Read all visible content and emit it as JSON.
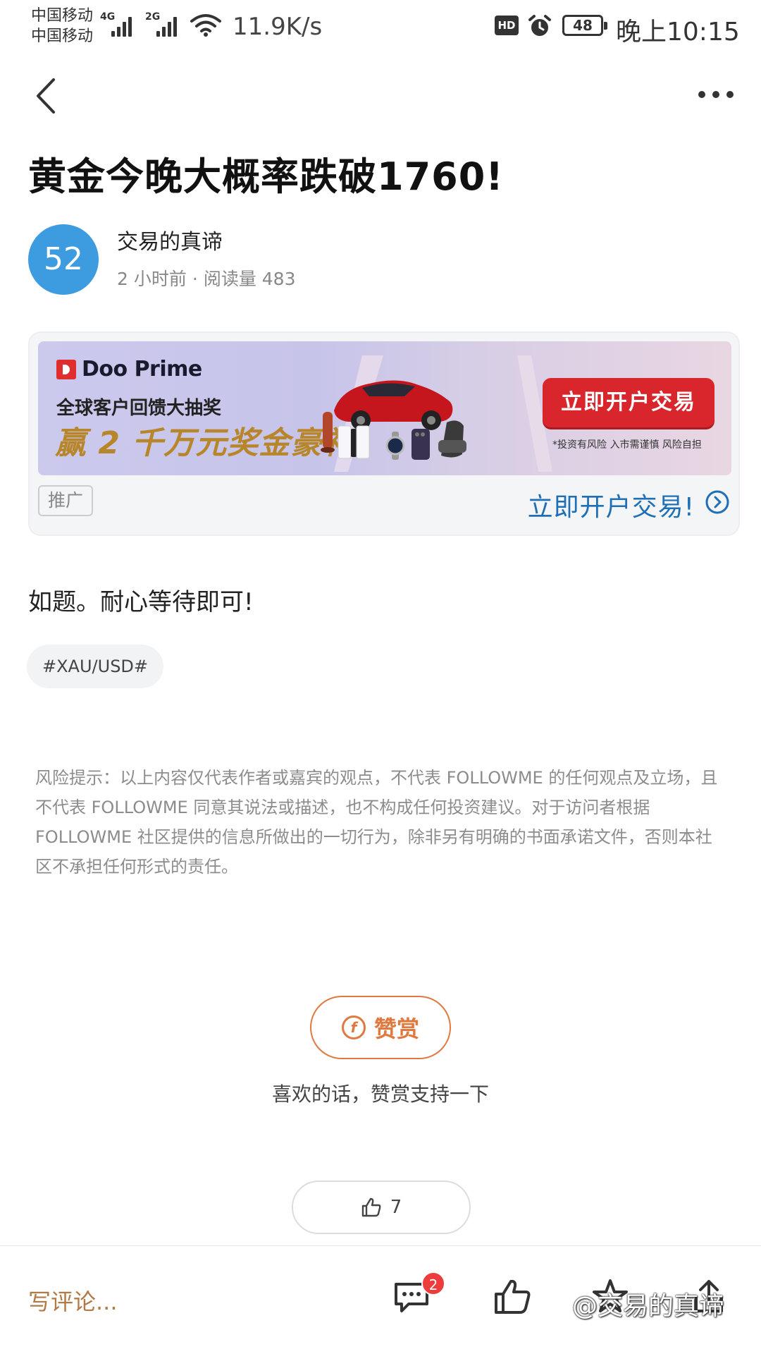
{
  "status_bar": {
    "carrier_1": "中国移动",
    "carrier_2": "中国移动",
    "net_1": "4G",
    "net_2": "2G",
    "speed": "11.9K/s",
    "hd": "HD",
    "battery": "48",
    "time": "晚上10:15"
  },
  "article": {
    "title": "黄金今晚大概率跌破1760!",
    "author": {
      "avatar_text": "52",
      "avatar_color": "#3d9be0",
      "name": "交易的真谛",
      "time_ago": "2 小时前",
      "separator": "·",
      "reads": "阅读量 483"
    },
    "body": "如题。耐心等待即可!",
    "topic": "#XAU/USD#"
  },
  "ad": {
    "brand": "Doo Prime",
    "headline": "全球客户回馈大抽奖",
    "prize": "赢 2 千万元奖金豪礼",
    "button_label": "立即开户交易",
    "risk_note": "*投资有风险 入市需谨慎 风险自担",
    "tag": "推广",
    "action_text": "立即开户交易!",
    "accent_color": "#d9262c"
  },
  "disclaimer": "风险提示：以上内容仅代表作者或嘉宾的观点，不代表 FOLLOWME 的任何观点及立场，且不代表 FOLLOWME 同意其说法或描述，也不构成任何投资建议。对于访问者根据 FOLLOWME 社区提供的信息所做出的一切行为，除非另有明确的书面承诺文件，否则本社区不承担任何形式的责任。",
  "tip": {
    "coin_symbol": "f",
    "label": "赞赏",
    "caption": "喜欢的话，赞赏支持一下",
    "color": "#e0793f"
  },
  "likes": {
    "count": "7"
  },
  "bottom_bar": {
    "comment_placeholder": "写评论...",
    "comment_badge": "2",
    "watermark": "@交易的真谛"
  }
}
